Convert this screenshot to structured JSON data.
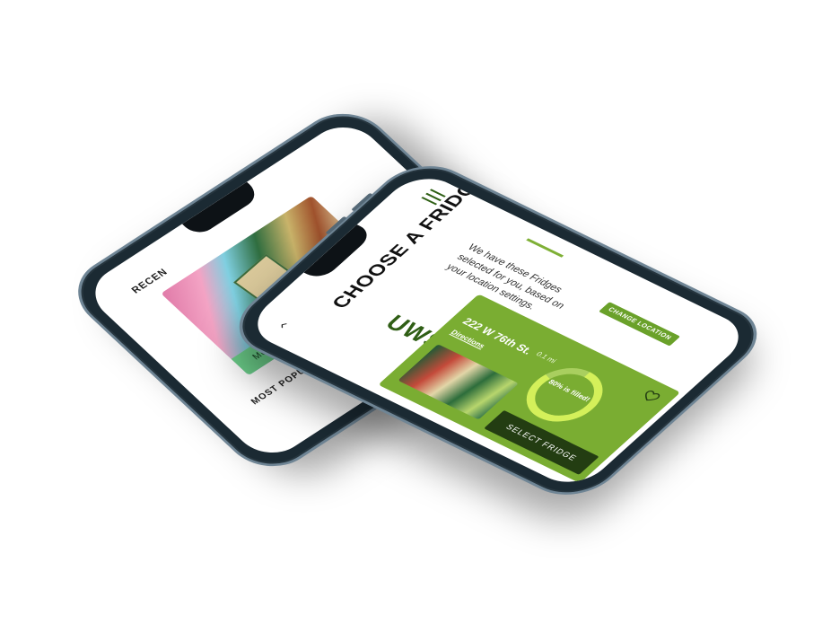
{
  "back_screen": {
    "recent_heading": "RECEN",
    "photo_caption": "Mott Haven Community Fridge",
    "popular_heading": "MOST POPULAR DONATED ITEMS"
  },
  "front_screen": {
    "title": "CHOOSE A FRIDGE",
    "subtitle": "We have these Fridges selected for you, based on your location settings.",
    "change_location_label": "CHANGE LOCATION",
    "area": "UWS",
    "card": {
      "address": "222 W 76th St.",
      "distance": "0.1 mi",
      "directions_label": "Directions",
      "fill_text": "80% is filled!",
      "fill_fraction": 0.8,
      "select_label": "SELECT FRIDGE"
    }
  },
  "icons": {
    "menu": "hamburger-menu-icon",
    "back": "chevron-left-icon",
    "favorite": "heart-icon"
  },
  "colors": {
    "accent_green": "#7aad32",
    "dark_green": "#233d12",
    "gauge_fill": "#d4f05a"
  }
}
